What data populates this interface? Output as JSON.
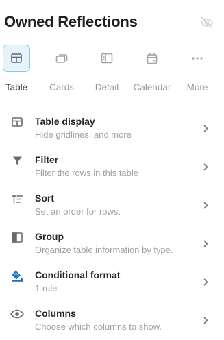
{
  "header": {
    "title": "Owned Reflections"
  },
  "views": [
    {
      "label": "Table",
      "icon": "table-icon",
      "active": true
    },
    {
      "label": "Cards",
      "icon": "cards-icon",
      "active": false
    },
    {
      "label": "Detail",
      "icon": "detail-icon",
      "active": false
    },
    {
      "label": "Calendar",
      "icon": "calendar-icon",
      "active": false
    },
    {
      "label": "More",
      "icon": "more-dots-icon",
      "active": false
    }
  ],
  "options": [
    {
      "name": "Table display",
      "desc": "Hide gridlines, and more",
      "icon": "table-icon"
    },
    {
      "name": "Filter",
      "desc": "Filter the rows in this table",
      "icon": "filter-icon"
    },
    {
      "name": "Sort",
      "desc": "Set an order for rows.",
      "icon": "sort-icon"
    },
    {
      "name": "Group",
      "desc": "Organize table information by type.",
      "icon": "group-icon"
    },
    {
      "name": "Conditional format",
      "desc": "1 rule",
      "icon": "paint-bucket-icon"
    },
    {
      "name": "Columns",
      "desc": "Choose which columns to show.",
      "icon": "eye-icon"
    }
  ],
  "colors": {
    "accent": "#1a73c9",
    "active_bg": "#e6f3fb",
    "active_border": "#8cc4e6",
    "muted": "#a0a0a0"
  }
}
